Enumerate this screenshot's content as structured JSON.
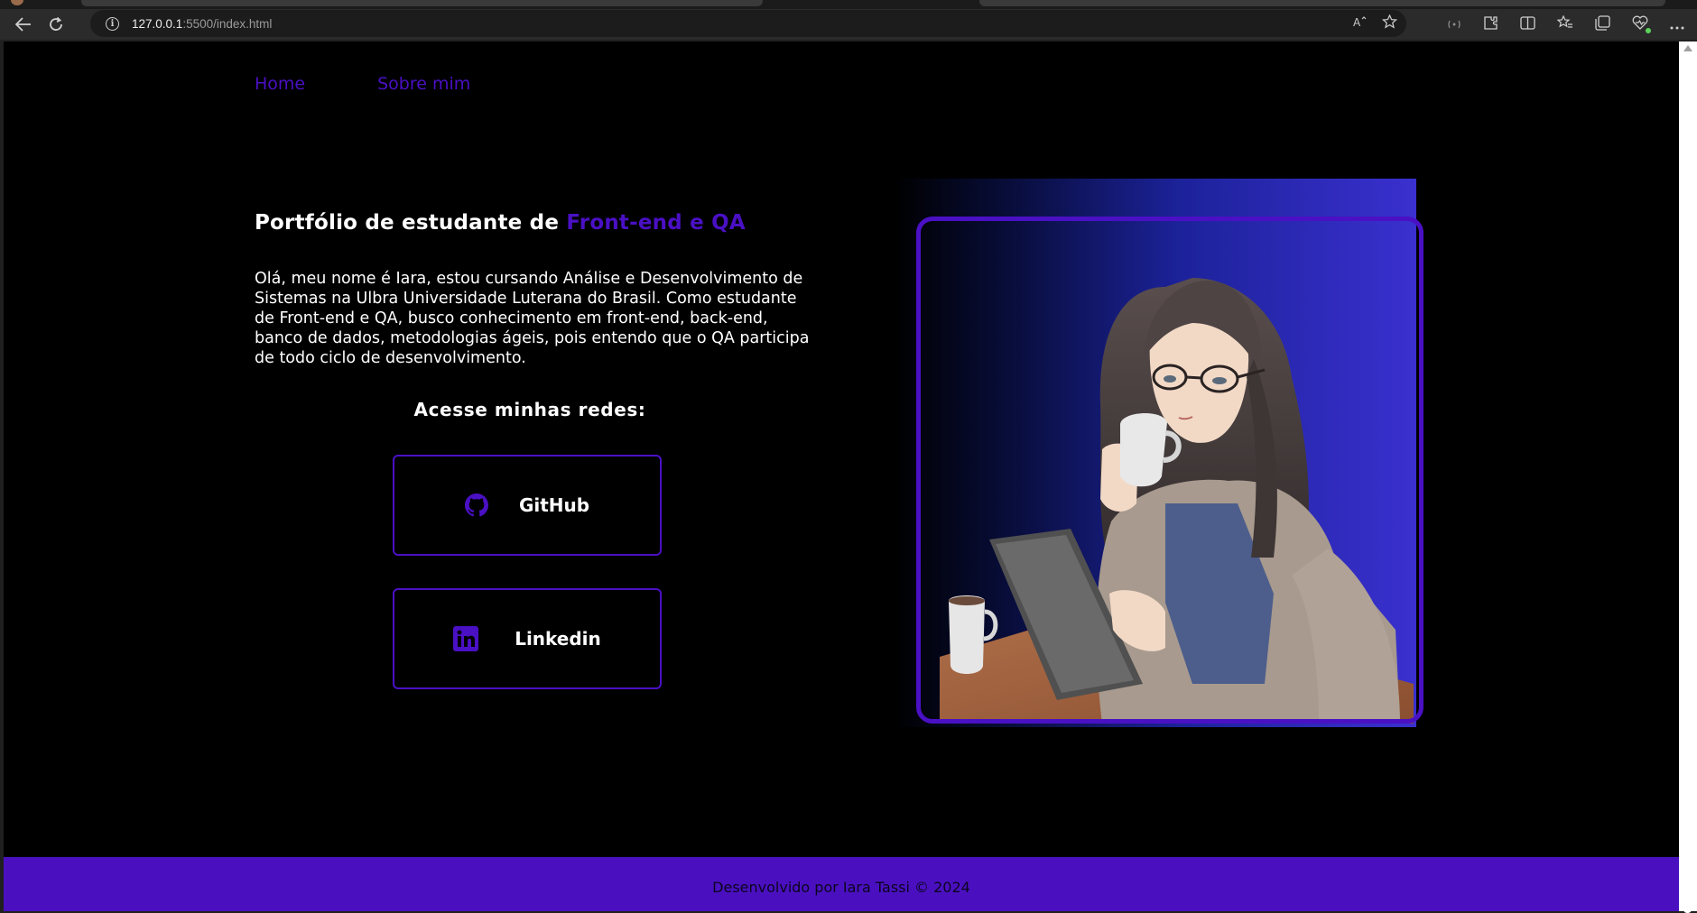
{
  "browser": {
    "url_host": "127.0.0.1",
    "url_path": ":5500/index.html"
  },
  "nav": {
    "home": "Home",
    "about": "Sobre mim"
  },
  "hero": {
    "title_prefix": "Portfólio de estudante de ",
    "title_accent": "Front-end e QA",
    "intro": "Olá, meu nome é Iara, estou cursando Análise e Desenvolvimento de Sistemas na Ulbra Universidade Luterana do Brasil. Como estudante de Front-end e QA, busco conhecimento em front-end, back-end, banco de dados, metodologias ágeis, pois entendo que o QA participa de todo ciclo de desenvolvimento."
  },
  "social": {
    "title": "Acesse minhas redes:",
    "github_label": "GitHub",
    "linkedin_label": "Linkedin"
  },
  "footer": {
    "text": "Desenvolvido por Iara Tassi © 2024"
  },
  "colors": {
    "accent": "#4a10c4",
    "page_bg": "#000000",
    "footer_bg": "#4a10c0",
    "text": "#ffffff"
  },
  "icons": [
    "back-arrow-icon",
    "refresh-icon",
    "info-icon",
    "read-aloud-icon",
    "favorite-star-icon",
    "extensions-icon",
    "split-screen-icon",
    "favorites-icon",
    "collections-icon",
    "browser-essentials-icon",
    "more-icon",
    "github-icon",
    "linkedin-icon"
  ]
}
